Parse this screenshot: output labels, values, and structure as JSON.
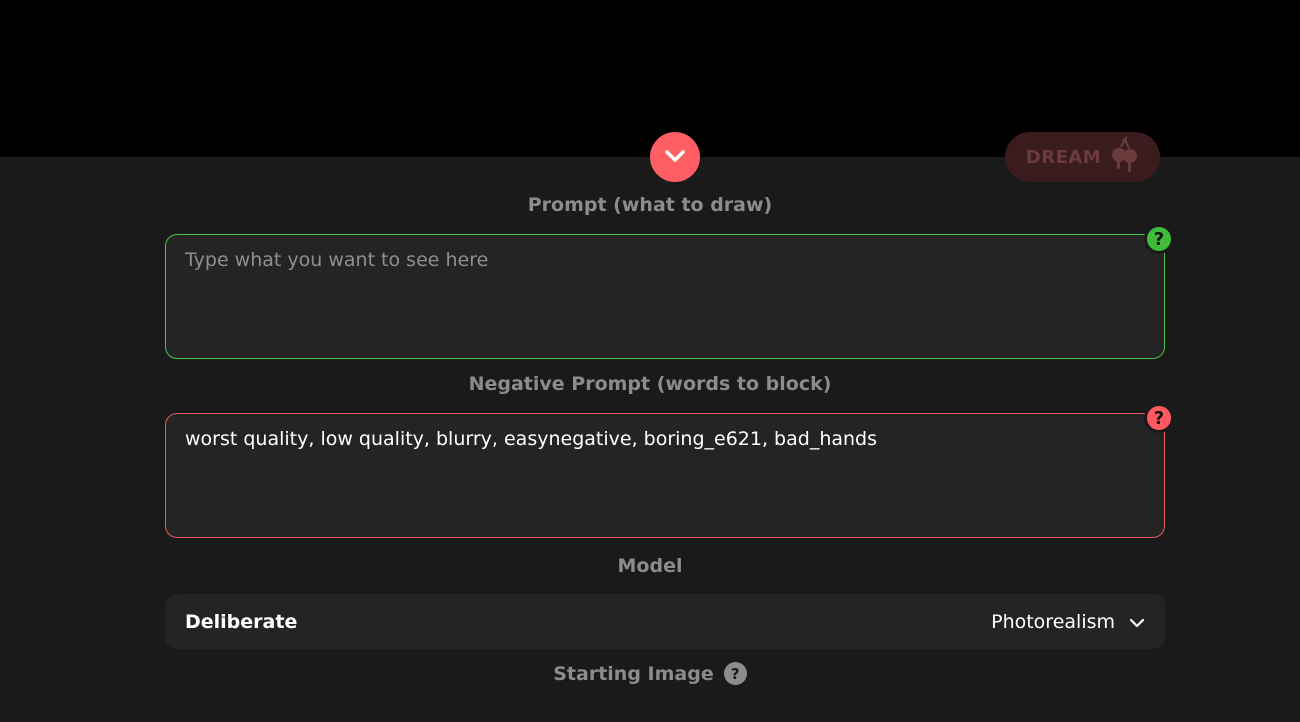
{
  "header": {
    "dream_label": "DREAM"
  },
  "prompt": {
    "label": "Prompt (what to draw)",
    "placeholder": "Type what you want to see here",
    "value": "",
    "help": "?"
  },
  "negative_prompt": {
    "label": "Negative Prompt (words to block)",
    "value": "worst quality, low quality, blurry, easynegative, boring_e621, bad_hands",
    "help": "?"
  },
  "model": {
    "label": "Model",
    "name": "Deliberate",
    "category": "Photorealism"
  },
  "starting_image": {
    "label": "Starting Image",
    "help": "?"
  },
  "colors": {
    "accent": "#ff5f64",
    "prompt_border": "#4cc24a",
    "negative_border": "#e4595e",
    "background": "#1a1a1a",
    "field_bg": "#242424"
  },
  "icons": {
    "collapse": "chevron-down-icon",
    "dream": "cherry-icon",
    "model_dropdown": "chevron-down-icon"
  }
}
